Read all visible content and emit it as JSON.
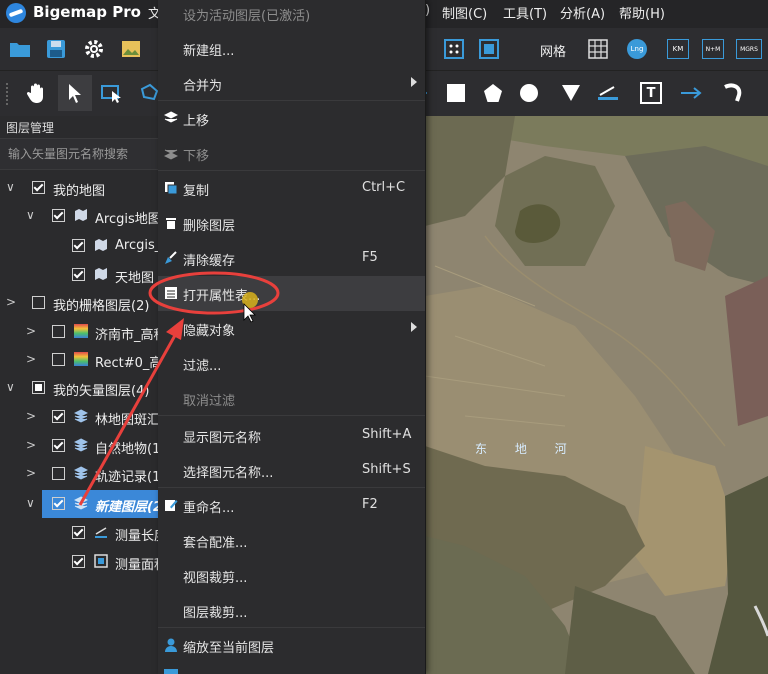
{
  "app": {
    "title": "Bigemap Pro"
  },
  "menubar": {
    "items": [
      {
        "label": "文"
      },
      {
        "label": ")"
      },
      {
        "label": "制图(C)"
      },
      {
        "label": "工具(T)"
      },
      {
        "label": "分析(A)"
      },
      {
        "label": "帮助(H)"
      }
    ]
  },
  "toolbar": {
    "grid_label": "网格",
    "lng_label": "Lng",
    "km_label": "KM",
    "nm_label": "N+M",
    "mgrs_label": "MGRS"
  },
  "layer_panel": {
    "title": "图层管理",
    "search_placeholder": "输入矢量图元名称搜索",
    "items": [
      {
        "label": "我的地图"
      },
      {
        "label": "Arcgis地图"
      },
      {
        "label": "Arcgis_"
      },
      {
        "label": "天地图"
      },
      {
        "label": "我的栅格图层(2)"
      },
      {
        "label": "济南市_高程"
      },
      {
        "label": "Rect#0_高"
      },
      {
        "label": "我的矢量图层(4)"
      },
      {
        "label": "林地图斑汇"
      },
      {
        "label": "自然地物(1"
      },
      {
        "label": "轨迹记录(1"
      },
      {
        "label": "新建图层(2"
      },
      {
        "label": "测量长度"
      },
      {
        "label": "测量面积"
      }
    ]
  },
  "context_menu": {
    "items": [
      {
        "label": "设为活动图层(已激活)",
        "shortcut": ""
      },
      {
        "label": "新建组...",
        "shortcut": ""
      },
      {
        "label": "合并为",
        "shortcut": ""
      },
      {
        "label": "上移",
        "shortcut": ""
      },
      {
        "label": "下移",
        "shortcut": ""
      },
      {
        "label": "复制",
        "shortcut": "Ctrl+C"
      },
      {
        "label": "删除图层",
        "shortcut": ""
      },
      {
        "label": "清除缓存",
        "shortcut": "F5"
      },
      {
        "label": "打开属性表...",
        "shortcut": ""
      },
      {
        "label": "隐藏对象",
        "shortcut": ""
      },
      {
        "label": "过滤...",
        "shortcut": ""
      },
      {
        "label": "取消过滤",
        "shortcut": ""
      },
      {
        "label": "显示图元名称",
        "shortcut": "Shift+A"
      },
      {
        "label": "选择图元名称...",
        "shortcut": "Shift+S"
      },
      {
        "label": "重命名...",
        "shortcut": "F2"
      },
      {
        "label": "套合配准...",
        "shortcut": ""
      },
      {
        "label": "视图裁剪...",
        "shortcut": ""
      },
      {
        "label": "图层裁剪...",
        "shortcut": ""
      },
      {
        "label": "缩放至当前图层",
        "shortcut": ""
      }
    ]
  },
  "map": {
    "river_label": "东 地 河"
  },
  "colors": {
    "accent": "#3b88d8",
    "annotation": "#e8403c",
    "menu_bg": "#2c2c2e"
  }
}
